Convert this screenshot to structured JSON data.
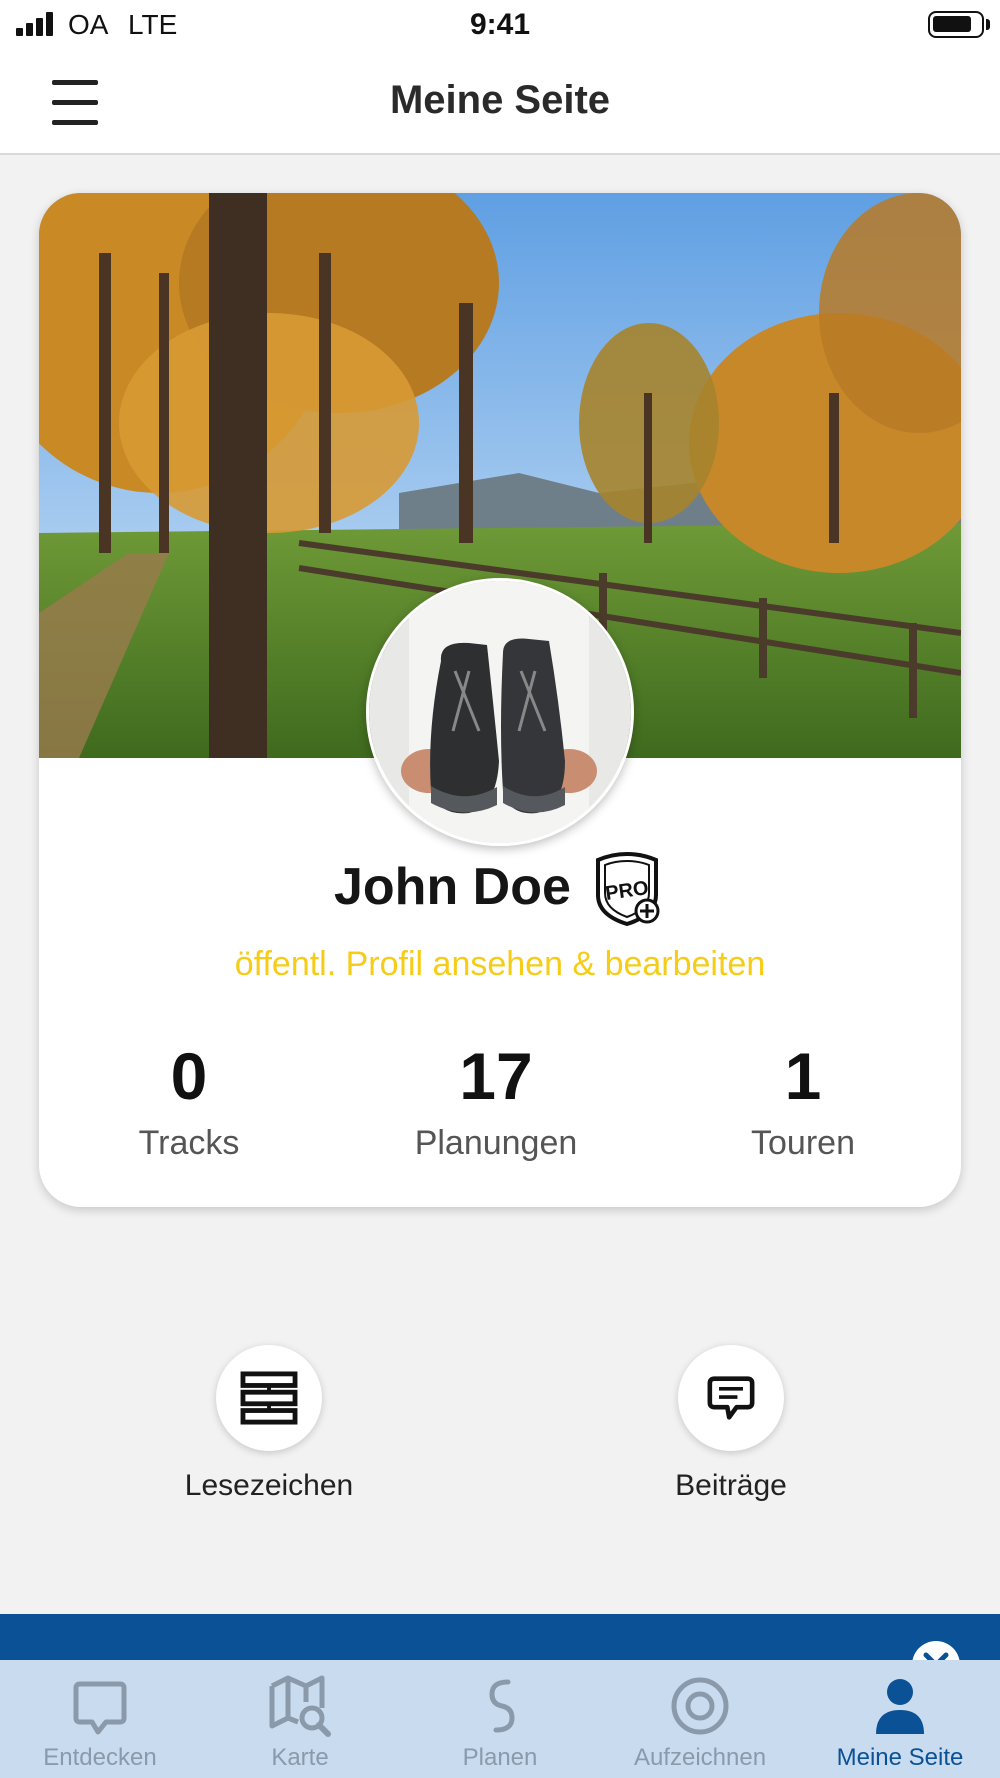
{
  "status_bar": {
    "carrier": "OA",
    "network": "LTE",
    "time": "9:41"
  },
  "header": {
    "title": "Meine Seite"
  },
  "profile": {
    "name": "John Doe",
    "badge": "PRO",
    "profile_link": "öffentl. Profil ansehen & bearbeiten",
    "stats": [
      {
        "value": "0",
        "label": "Tracks"
      },
      {
        "value": "17",
        "label": "Planungen"
      },
      {
        "value": "1",
        "label": "Touren"
      }
    ]
  },
  "actions": [
    {
      "label": "Lesezeichen",
      "icon": "bookmark-list-icon"
    },
    {
      "label": "Beiträge",
      "icon": "chat-bubble-icon"
    }
  ],
  "tab_bar": {
    "tabs": [
      {
        "label": "Entdecken",
        "icon": "discover-icon",
        "active": false
      },
      {
        "label": "Karte",
        "icon": "map-search-icon",
        "active": false
      },
      {
        "label": "Planen",
        "icon": "route-icon",
        "active": false
      },
      {
        "label": "Aufzeichnen",
        "icon": "record-icon",
        "active": false
      },
      {
        "label": "Meine Seite",
        "icon": "user-icon",
        "active": true
      }
    ]
  },
  "colors": {
    "accent_yellow": "#f6cc17",
    "brand_blue": "#0b5196",
    "tab_bar_background": "#c9dbef",
    "tab_inactive": "#8a9aab"
  }
}
